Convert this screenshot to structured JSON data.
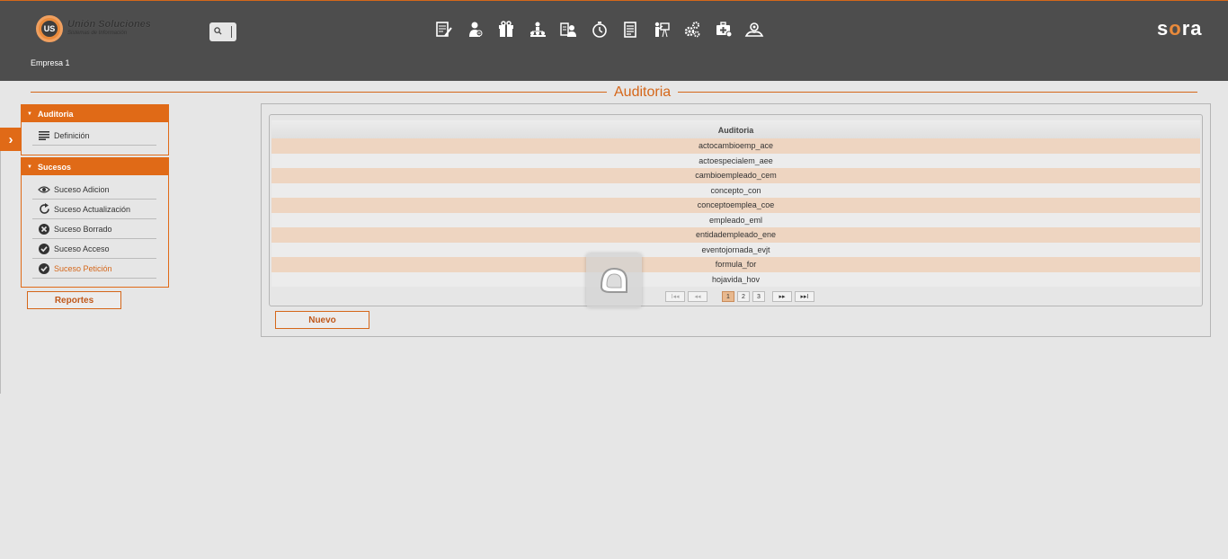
{
  "header": {
    "logo_initials": "US",
    "logo_title": "Unión Soluciones",
    "logo_subtitle": "Sistemas de Información",
    "company": "Empresa 1",
    "search_icon": "search-icon",
    "nav_icons": [
      "document-edit-icon",
      "user-add-icon",
      "gift-icon",
      "org-chart-icon",
      "employee-card-icon",
      "timer-icon",
      "report-icon",
      "training-icon",
      "settings-gears-icon",
      "medical-kit-icon",
      "user-group-icon"
    ],
    "brand": {
      "before": "s",
      "accent": "o",
      "after": "ra"
    },
    "colors": {
      "bar": "#4d4d4d",
      "accent": "#d5671a"
    }
  },
  "page": {
    "title": "Auditoria"
  },
  "sidebar": {
    "toggle_icon": "chevron-right-icon",
    "panels": [
      {
        "title": "Auditoria",
        "items": [
          {
            "label": "Definición",
            "icon": "list-icon"
          }
        ]
      },
      {
        "title": "Sucesos",
        "items": [
          {
            "label": "Suceso Adicion",
            "icon": "eye-icon"
          },
          {
            "label": "Suceso Actualización",
            "icon": "refresh-icon"
          },
          {
            "label": "Suceso Borrado",
            "icon": "delete-circle-icon"
          },
          {
            "label": "Suceso Acceso",
            "icon": "check-circle-icon"
          },
          {
            "label": "Suceso Petición",
            "icon": "check-circle-icon",
            "active": true
          }
        ]
      }
    ],
    "reports_button": "Reportes"
  },
  "grid": {
    "header": "Auditoria",
    "rows": [
      "actocambioemp_ace",
      "actoespecialem_aee",
      "cambioempleado_cem",
      "concepto_con",
      "conceptoemplea_coe",
      "empleado_eml",
      "entidadempleado_ene",
      "eventojornada_evjt",
      "formula_for",
      "hojavida_hov"
    ],
    "pager": {
      "first": "I◂◂",
      "prev": "◂◂",
      "pages": [
        "1",
        "2",
        "3"
      ],
      "current": "1",
      "next": "▸▸",
      "last": "▸▸I"
    }
  },
  "new_button": "Nuevo"
}
